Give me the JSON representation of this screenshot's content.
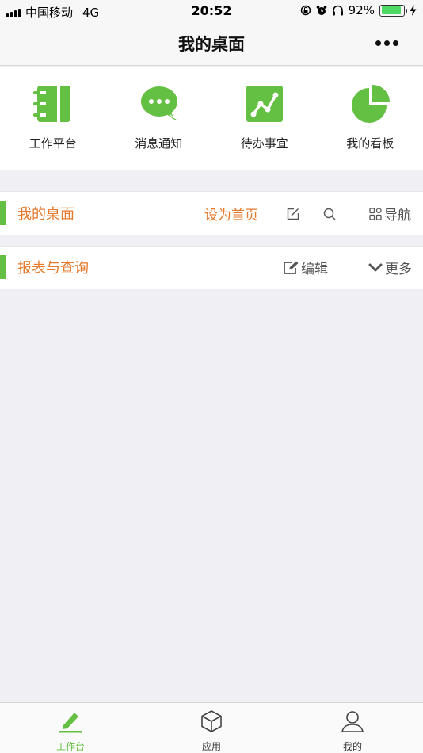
{
  "status_bar": {
    "carrier": "中国移动",
    "network": "4G",
    "time": "20:52",
    "battery": "92%",
    "battery_level": 0.92
  },
  "header": {
    "title": "我的桌面",
    "more_icon": "ellipsis-icon"
  },
  "quick_actions": [
    {
      "label": "工作平台",
      "icon": "notebook-icon"
    },
    {
      "label": "消息通知",
      "icon": "chat-bubble-icon"
    },
    {
      "label": "待办事宜",
      "icon": "trend-chart-icon"
    },
    {
      "label": "我的看板",
      "icon": "pie-chart-icon"
    }
  ],
  "desktop_section": {
    "title": "我的桌面",
    "set_home_label": "设为首页",
    "nav_label": "导航"
  },
  "report_section": {
    "title": "报表与查询",
    "edit_label": "编辑",
    "more_label": "更多"
  },
  "tab_bar": [
    {
      "label": "工作台",
      "icon": "pencil-icon",
      "active": true
    },
    {
      "label": "应用",
      "icon": "cube-icon",
      "active": false
    },
    {
      "label": "我的",
      "icon": "person-icon",
      "active": false
    }
  ],
  "colors": {
    "brand_green": "#64c043",
    "accent_orange": "#e5792c",
    "background": "#f0f0f4"
  }
}
